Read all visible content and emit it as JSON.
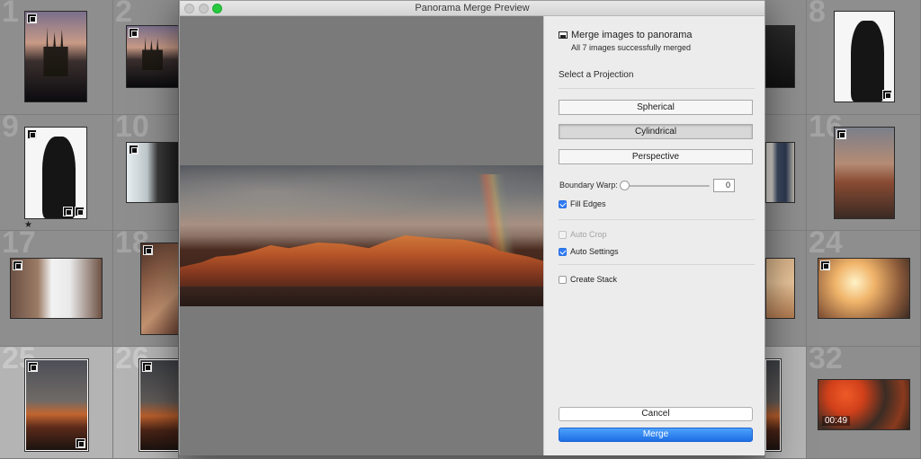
{
  "dialog": {
    "title": "Panorama Merge Preview",
    "heading": "Merge images to panorama",
    "status": "All 7 images successfully merged",
    "projection_label": "Select a Projection",
    "projections": [
      "Spherical",
      "Cylindrical",
      "Perspective"
    ],
    "selected_projection": "Cylindrical",
    "boundary_warp": {
      "label": "Boundary Warp:",
      "value": "0",
      "level": 0
    },
    "options": [
      {
        "label": "Fill Edges",
        "checked": true,
        "enabled": true
      },
      {
        "label": "Auto Crop",
        "checked": false,
        "enabled": false
      },
      {
        "label": "Auto Settings",
        "checked": true,
        "enabled": true
      },
      {
        "label": "Create Stack",
        "checked": false,
        "enabled": true
      }
    ],
    "cancel_label": "Cancel",
    "merge_label": "Merge",
    "accent_color": "#1d6ee6"
  },
  "grid": {
    "numbers": [
      "1",
      "2",
      "8",
      "9",
      "10",
      "16",
      "17",
      "18",
      "24",
      "25",
      "26",
      "32"
    ],
    "star": "★",
    "video_duration": "00:49"
  }
}
